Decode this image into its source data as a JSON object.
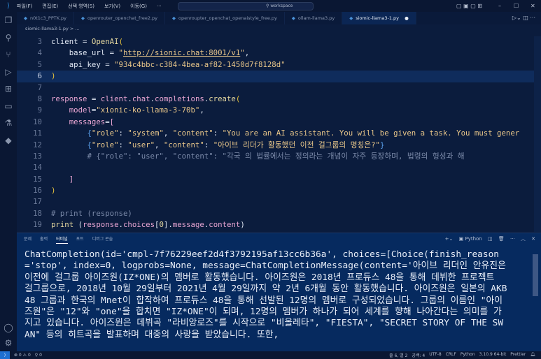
{
  "titlebar": {
    "menus": [
      "파일(F)",
      "편집(E)",
      "선택 영역(S)",
      "보기(V)",
      "이동(G)",
      "···"
    ],
    "search": "workspace"
  },
  "tabs": [
    {
      "label": "n0t1c3_PPTK.py",
      "active": false
    },
    {
      "label": "openrouter_openchat_free2.py",
      "active": false
    },
    {
      "label": "openroupter_openchat_openaistyle_free.py",
      "active": false
    },
    {
      "label": "ollam-llama3.py",
      "active": false
    },
    {
      "label": "siomic-llama3-1.py",
      "active": true,
      "modified": "●"
    }
  ],
  "breadcrumb": "siomic-llama3-1.py > ...",
  "code": [
    {
      "n": "3",
      "t": [
        [
          "client",
          "v"
        ],
        [
          " = ",
          "v"
        ],
        [
          "OpenAI",
          "f"
        ],
        [
          "(",
          "p"
        ]
      ]
    },
    {
      "n": "4",
      "t": [
        [
          "    base_url",
          "v"
        ],
        [
          " = ",
          "v"
        ],
        [
          "\"",
          "s"
        ],
        [
          "http://sionic.chat:8001/v1",
          "u"
        ],
        [
          "\"",
          "s"
        ],
        [
          ",",
          "v"
        ]
      ]
    },
    {
      "n": "5",
      "t": [
        [
          "    api_key",
          "v"
        ],
        [
          " = ",
          "v"
        ],
        [
          "\"934c4bbc-c384-4bea-af82-1450d7f8128d\"",
          "s"
        ]
      ]
    },
    {
      "n": "6",
      "cur": true,
      "t": [
        [
          ")",
          "p"
        ]
      ]
    },
    {
      "n": "7",
      "t": []
    },
    {
      "n": "8",
      "t": [
        [
          "response",
          "k"
        ],
        [
          " = ",
          "v"
        ],
        [
          "client",
          "k"
        ],
        [
          ".",
          "v"
        ],
        [
          "chat",
          "k"
        ],
        [
          ".",
          "v"
        ],
        [
          "completions",
          "k"
        ],
        [
          ".",
          "v"
        ],
        [
          "create",
          "f"
        ],
        [
          "(",
          "p"
        ]
      ]
    },
    {
      "n": "9",
      "t": [
        [
          "    model",
          "k"
        ],
        [
          "=",
          "v"
        ],
        [
          "\"xionic-ko-llama-3-70b\"",
          "s"
        ],
        [
          ",",
          "v"
        ]
      ]
    },
    {
      "n": "10",
      "t": [
        [
          "    messages",
          "k"
        ],
        [
          "=",
          "v"
        ],
        [
          "[",
          "k"
        ]
      ]
    },
    {
      "n": "11",
      "t": [
        [
          "        {",
          "b"
        ],
        [
          "\"role\"",
          "s"
        ],
        [
          ": ",
          "v"
        ],
        [
          "\"system\"",
          "s"
        ],
        [
          ", ",
          "v"
        ],
        [
          "\"content\"",
          "s"
        ],
        [
          ": ",
          "v"
        ],
        [
          "\"You are an AI assistant. You will be given a task. You must gener",
          "s"
        ]
      ]
    },
    {
      "n": "12",
      "t": [
        [
          "        {",
          "b"
        ],
        [
          "\"role\"",
          "s"
        ],
        [
          ": ",
          "v"
        ],
        [
          "\"user\"",
          "s"
        ],
        [
          ", ",
          "v"
        ],
        [
          "\"content\"",
          "s"
        ],
        [
          ": ",
          "v"
        ],
        [
          "\"아이브 리더가 활동했던 이전 걸그룹의 명칭은?\"",
          "s"
        ],
        [
          "}",
          "b"
        ]
      ]
    },
    {
      "n": "13",
      "t": [
        [
          "        # {\"role\": \"user\", \"content\": \"각국 의 법률에서는 정의라는 개념이 자주 등장하며, 법령의 형성과 해",
          "c"
        ]
      ]
    },
    {
      "n": "14",
      "t": []
    },
    {
      "n": "15",
      "t": [
        [
          "    ]",
          "k"
        ]
      ]
    },
    {
      "n": "16",
      "t": [
        [
          ")",
          "p"
        ]
      ]
    },
    {
      "n": "17",
      "t": []
    },
    {
      "n": "18",
      "t": [
        [
          "# print (response)",
          "c"
        ]
      ]
    },
    {
      "n": "19",
      "t": [
        [
          "print",
          "f"
        ],
        [
          " (",
          "v"
        ],
        [
          "response",
          "k"
        ],
        [
          ".",
          "v"
        ],
        [
          "choices",
          "k"
        ],
        [
          "[",
          "v"
        ],
        [
          "0",
          "f"
        ],
        [
          "].",
          "v"
        ],
        [
          "message",
          "k"
        ],
        [
          ".",
          "v"
        ],
        [
          "content",
          "k"
        ],
        [
          ")",
          "v"
        ]
      ]
    }
  ],
  "panel": {
    "tabs": [
      "문제",
      "출력",
      "터미널",
      "포트",
      "디버그 콘솔"
    ],
    "active_tab": 2,
    "profile": "Python",
    "output": "ChatCompletion(id='cmpl-7f76229eef2d4f3792195af13cc6b36a', choices=[Choice(finish_reason='stop', index=0, logprobs=None, message=ChatCompletionMessage(content='아이브 리더인 안유진은 이전에 걸그룹 아이즈원(IZ*ONE)의 멤버로 활동했습니다. 아이즈원은 2018년 프로듀스 48을 통해 데뷔한 프로젝트 걸그룹으로, 2018년 10월 29일부터 2021년 4월 29일까지 약 2년 6개월 동안 활동했습니다. 아이즈원은 일본의 AKB48 그룹과 한국의 Mnet이 합작하여 프로듀스 48을 통해 선발된 12명의 멤버로 구성되었습니다. 그룹의 이름인 \"아이즈원\"은 \"12\"와 \"one\"을 합치면 \"IZ*ONE\"이 되며, 12명의 멤버가 하나가 되어 세계를 향해 나아간다는 의미를 가지고 있습니다. 아이즈원은 데뷔곡 \"라비앙로즈\"를 시작으로 \"비올레타\", \"FIESTA\", \"SECRET STORY OF THE SWAN\" 등의 히트곡을 발표하며 대중의 사랑을 받았습니다. 또한,"
  },
  "status": {
    "problems": "⊗ 0 ⚠ 0",
    "ports": "⚲ 0",
    "position": "줄 6, 열 2",
    "spaces": "공백: 4",
    "encoding": "UTF-8",
    "eol": "CRLF",
    "language": "Python",
    "interpreter": "3.10.9 64-bit",
    "formatter": "Prettier"
  }
}
